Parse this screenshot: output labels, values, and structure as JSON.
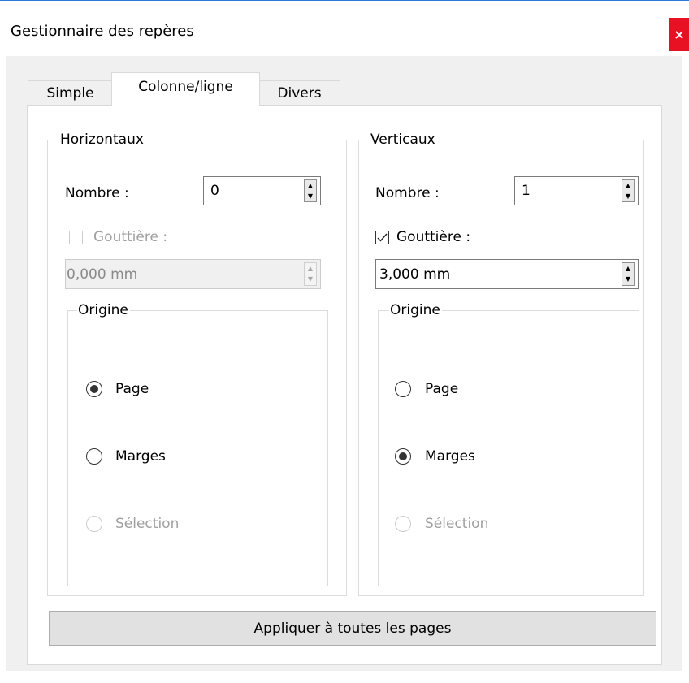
{
  "window": {
    "title": "Gestionnaire des repères",
    "close_glyph": "×"
  },
  "tabs": [
    {
      "label": "Simple",
      "active": false
    },
    {
      "label": "Colonne/ligne",
      "active": true
    },
    {
      "label": "Divers",
      "active": false
    }
  ],
  "horizontal": {
    "group_label": "Horizontaux",
    "count_label": "Nombre :",
    "count_value": "0",
    "gutter_label": "Gouttière :",
    "gutter_checked": false,
    "gutter_enabled": false,
    "gutter_value": "0,000 mm",
    "origin": {
      "group_label": "Origine",
      "options": [
        {
          "label": "Page",
          "selected": true,
          "enabled": true
        },
        {
          "label": "Marges",
          "selected": false,
          "enabled": true
        },
        {
          "label": "Sélection",
          "selected": false,
          "enabled": false
        }
      ]
    }
  },
  "vertical": {
    "group_label": "Verticaux",
    "count_label": "Nombre :",
    "count_value": "1",
    "gutter_label": "Gouttière :",
    "gutter_checked": true,
    "gutter_enabled": true,
    "gutter_value": "3,000 mm",
    "origin": {
      "group_label": "Origine",
      "options": [
        {
          "label": "Page",
          "selected": false,
          "enabled": true
        },
        {
          "label": "Marges",
          "selected": true,
          "enabled": true
        },
        {
          "label": "Sélection",
          "selected": false,
          "enabled": false
        }
      ]
    }
  },
  "apply_label": "Appliquer à toutes les pages",
  "icons": {
    "check": "check-icon",
    "spin_up": "spin-up-icon",
    "spin_down": "spin-down-icon",
    "close": "close-icon"
  },
  "colors": {
    "close_bg": "#e81123",
    "title_border": "#2b79d7",
    "panel_bg": "#f0f0f0"
  }
}
